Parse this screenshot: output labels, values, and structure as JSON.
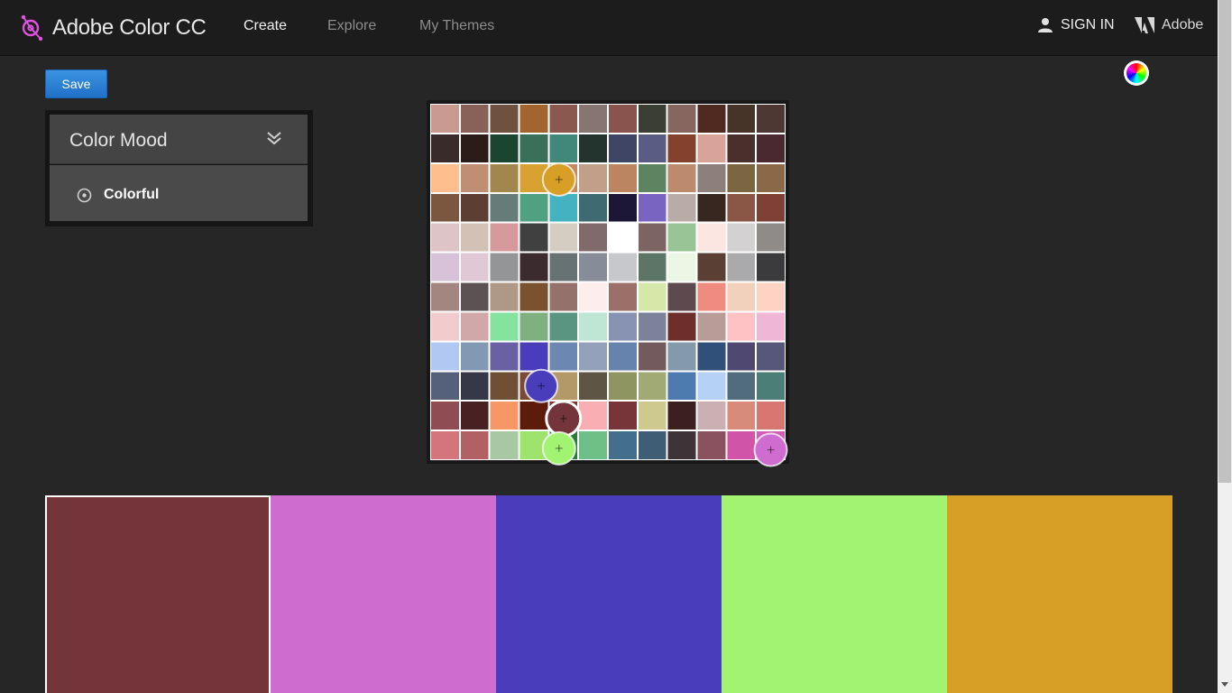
{
  "header": {
    "app_title": "Adobe Color CC",
    "nav": [
      {
        "label": "Create",
        "active": true
      },
      {
        "label": "Explore",
        "active": false
      },
      {
        "label": "My Themes",
        "active": false
      }
    ],
    "sign_in_label": "SIGN IN",
    "adobe_label": "Adobe",
    "icons": {
      "logo": "adobe-color-logo-icon",
      "user": "user-icon",
      "adobe": "adobe-logo-icon"
    }
  },
  "toolbar": {
    "save_label": "Save",
    "color_wheel_icon": "color-wheel-icon"
  },
  "color_mood": {
    "title": "Color Mood",
    "selected_option": "Colorful",
    "collapse_icon": "double-chevron-down-icon",
    "option_icon": "radio-circle-icon"
  },
  "image_grid": {
    "cols": 12,
    "rows": 12,
    "colors": [
      [
        "#c99a8f",
        "#8a6159",
        "#6f5140",
        "#a3652f",
        "#8b584f",
        "#877571",
        "#88544d",
        "#3b3e32",
        "#876660",
        "#502a21",
        "#463428",
        "#4e3834"
      ],
      [
        "#3a2b2b",
        "#2b1c1a",
        "#1a4531",
        "#3a7059",
        "#41877a",
        "#23342f",
        "#3f4565",
        "#5a5c84",
        "#84412e",
        "#d8a398",
        "#4a302c",
        "#4a2a30"
      ],
      [
        "#ffbe8e",
        "#c08e73",
        "#a1864e",
        "#d8a232",
        "#c48a64",
        "#c19f89",
        "#bd8462",
        "#5e8360",
        "#bc8b6e",
        "#8c7f7c",
        "#7b6642",
        "#8b6848"
      ],
      [
        "#7b5740",
        "#5c3f32",
        "#667c78",
        "#4fa182",
        "#45b2c2",
        "#3e6a71",
        "#1c1637",
        "#7965c1",
        "#b9aba6",
        "#382721",
        "#8a5747",
        "#7f4035"
      ],
      [
        "#dec4c6",
        "#d4c1b6",
        "#d69a9d",
        "#404040",
        "#d3cec1",
        "#806a6c",
        "#ffffff",
        "#7c6463",
        "#99c496",
        "#fbe6e2",
        "#d3d1d1",
        "#8f8b89"
      ],
      [
        "#d7c2da",
        "#e0c8d5",
        "#949597",
        "#3b2a2e",
        "#667273",
        "#868d99",
        "#c7c8cb",
        "#5d7566",
        "#ebf7e4",
        "#5a3f35",
        "#aaa9ac",
        "#3b3b3e"
      ],
      [
        "#a48680",
        "#5c5153",
        "#b09886",
        "#7b5230",
        "#94716b",
        "#fdeded",
        "#9a7069",
        "#d6e8a9",
        "#5d494e",
        "#ee8c7f",
        "#f2d1bc",
        "#ffd3c3"
      ],
      [
        "#f2cccc",
        "#d2a7a9",
        "#85e3a0",
        "#80b07f",
        "#5a9582",
        "#bfe6d5",
        "#8893b3",
        "#7b8299",
        "#6d2f2b",
        "#b89c98",
        "#ffc2c4",
        "#f0b6d5"
      ],
      [
        "#b1c8f2",
        "#8299b4",
        "#6961a4",
        "#4a3dbb",
        "#6b87b2",
        "#93a2b8",
        "#6683ad",
        "#735a5d",
        "#8599ad",
        "#305079",
        "#4f4971",
        "#57577b"
      ],
      [
        "#55607a",
        "#363848",
        "#6f5037",
        "#7a4a36",
        "#b39967",
        "#5f5544",
        "#8f9560",
        "#a1aa75",
        "#4d7aaf",
        "#b5d2f4",
        "#516c7c",
        "#4b7e76"
      ],
      [
        "#8f4c52",
        "#482222",
        "#f89766",
        "#5d1b0c",
        "#7c3231",
        "#f9aeb3",
        "#77353a",
        "#cec98f",
        "#3c1f1f",
        "#cab0b2",
        "#d88b7b",
        "#d87772"
      ],
      [
        "#d4757b",
        "#b16063",
        "#a8c7a3",
        "#9de36e",
        "#2b7a3d",
        "#6fc088",
        "#436f8c",
        "#405d76",
        "#3e3437",
        "#8a515e",
        "#d054a8",
        "#d35db7"
      ]
    ]
  },
  "pickers": [
    {
      "color": "#d89f27",
      "col": 3.85,
      "row": 2.05,
      "style": "normal"
    },
    {
      "color": "#4a3dbb",
      "col": 3.25,
      "row": 9.0,
      "style": "normal"
    },
    {
      "color": "#73343a",
      "col": 4.0,
      "row": 10.1,
      "style": "selected"
    },
    {
      "color": "#a3f373",
      "col": 3.85,
      "row": 11.1,
      "style": "normal"
    },
    {
      "color": "#cf6ccf",
      "col": 11.0,
      "row": 11.15,
      "style": "normal"
    }
  ],
  "swatches": [
    {
      "color": "#73343a",
      "selected": true
    },
    {
      "color": "#cf6ccf",
      "selected": false
    },
    {
      "color": "#4a3dbb",
      "selected": false
    },
    {
      "color": "#a3f373",
      "selected": false
    },
    {
      "color": "#d89f27",
      "selected": false
    }
  ]
}
